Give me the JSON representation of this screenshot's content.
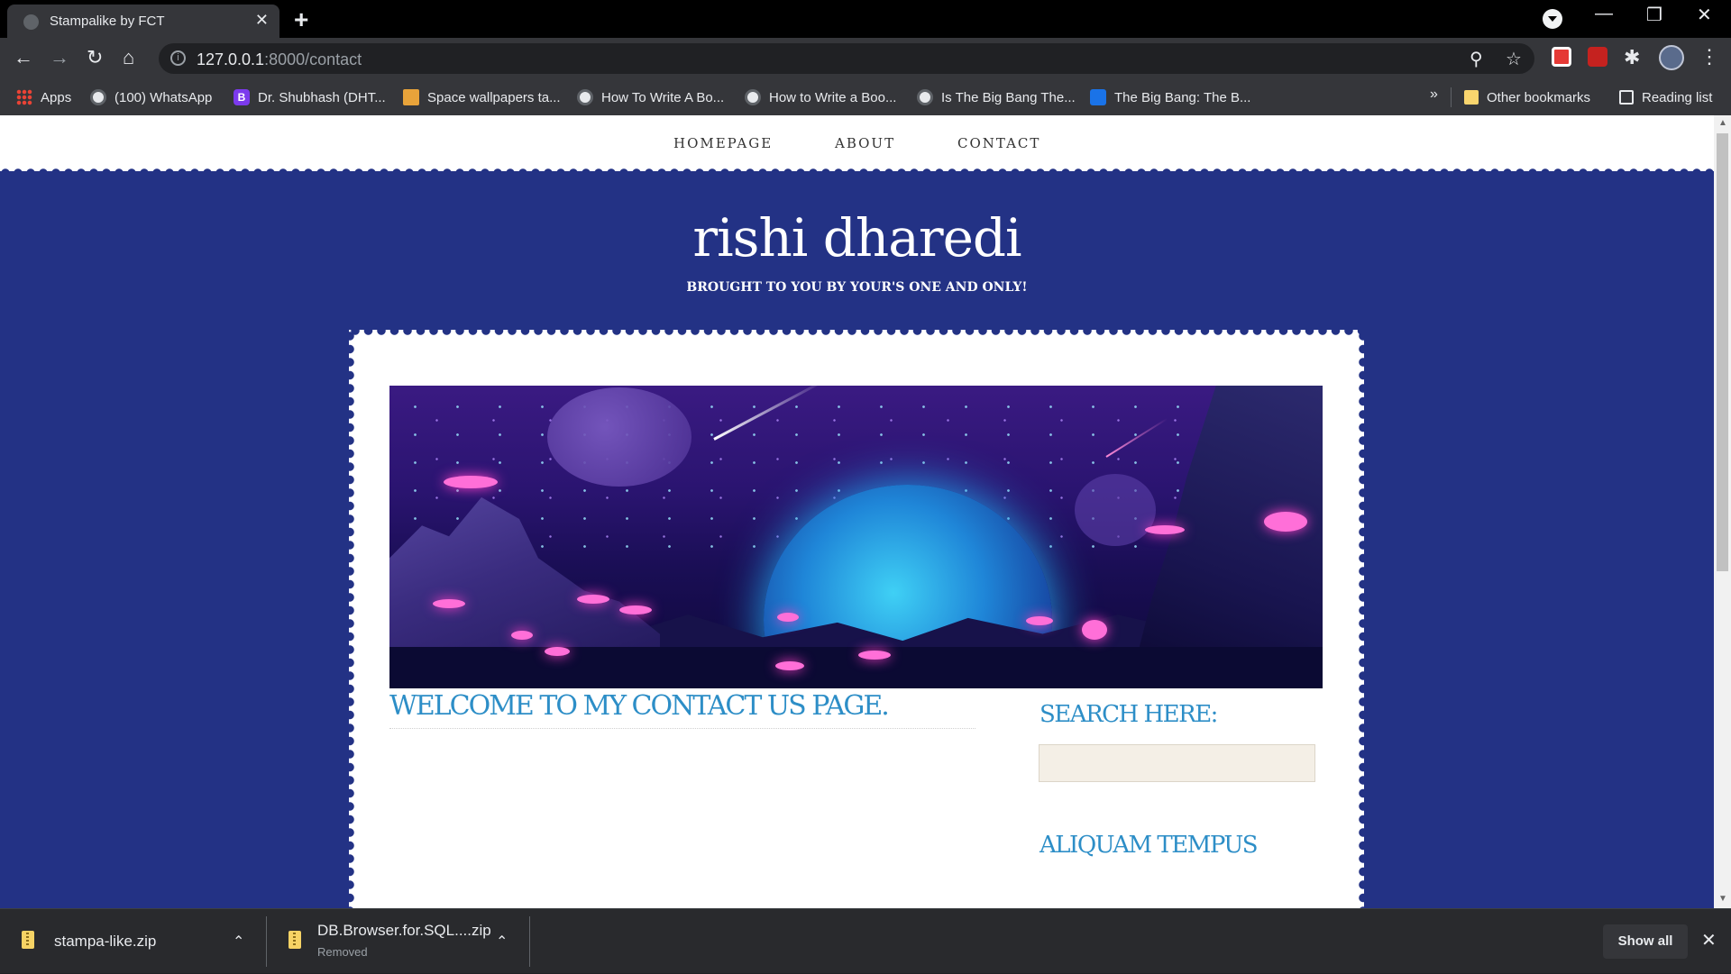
{
  "browser": {
    "tab_title": "Stampalike by FCT",
    "url_host": "127.0.0.1",
    "url_path": ":8000/contact",
    "bookmarks": [
      {
        "label": "Apps",
        "icon": "apps-grid-icon"
      },
      {
        "label": "(100) WhatsApp",
        "icon": "globe-icon"
      },
      {
        "label": "Dr. Shubhash (DHT...",
        "icon": "bootstrap-b-icon"
      },
      {
        "label": "Space wallpapers ta...",
        "icon": "stack-icon"
      },
      {
        "label": "How To Write A Bo...",
        "icon": "globe-icon"
      },
      {
        "label": "How to Write a Boo...",
        "icon": "globe-icon"
      },
      {
        "label": "Is The Big Bang The...",
        "icon": "globe-icon"
      },
      {
        "label": "The Big Bang: The B...",
        "icon": "blue-site-icon"
      }
    ],
    "more_bookmarks": "»",
    "other_bookmarks": "Other bookmarks",
    "reading_list": "Reading list"
  },
  "site": {
    "nav": [
      "HOMEPAGE",
      "ABOUT",
      "CONTACT"
    ],
    "title": "rishi dharedi",
    "tagline": "BROUGHT TO YOU BY YOUR'S ONE AND ONLY!",
    "content_heading": "WELCOME TO MY CONTACT US PAGE.",
    "search_heading": "SEARCH HERE:",
    "search_value": "",
    "widget2_heading": "ALIQUAM TEMPUS",
    "colors": {
      "background": "#233285",
      "heading": "#2d8ec7"
    }
  },
  "downloads": {
    "items": [
      {
        "name": "stampa-like.zip",
        "status": ""
      },
      {
        "name": "DB.Browser.for.SQL....zip",
        "status": "Removed"
      }
    ],
    "show_all": "Show all"
  }
}
